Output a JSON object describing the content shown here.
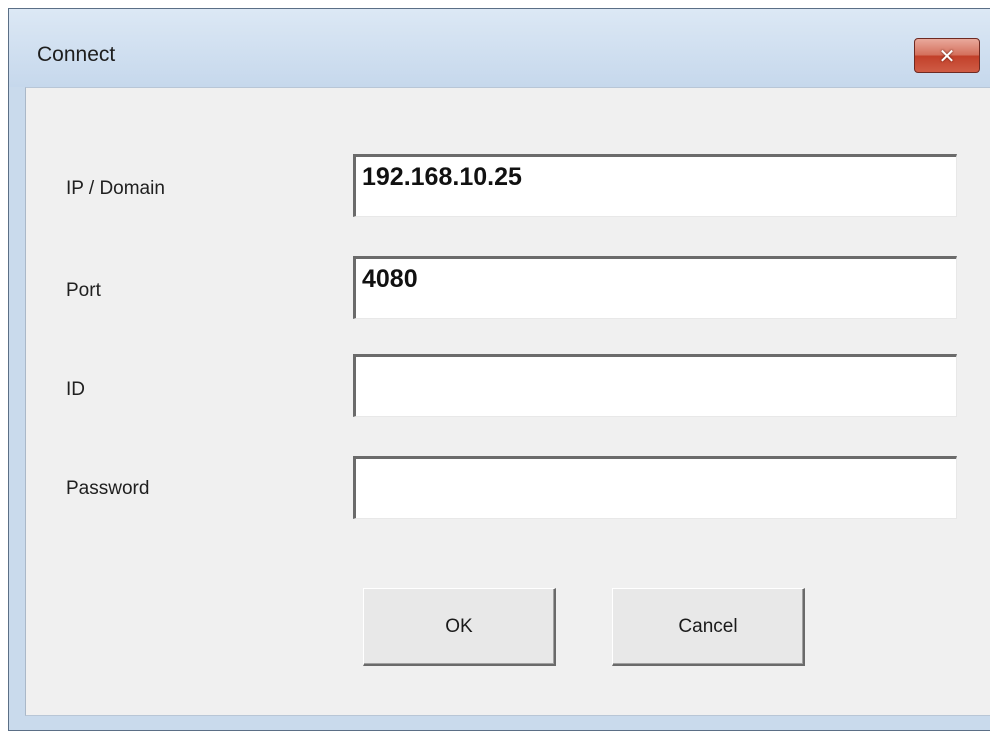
{
  "window": {
    "title": "Connect",
    "close_label": "✕"
  },
  "form": {
    "ip_label": "IP / Domain",
    "ip_value": "192.168.10.25",
    "port_label": "Port",
    "port_value": "4080",
    "id_label": "ID",
    "id_value": "",
    "password_label": "Password",
    "password_value": ""
  },
  "buttons": {
    "ok_label": "OK",
    "cancel_label": "Cancel"
  }
}
